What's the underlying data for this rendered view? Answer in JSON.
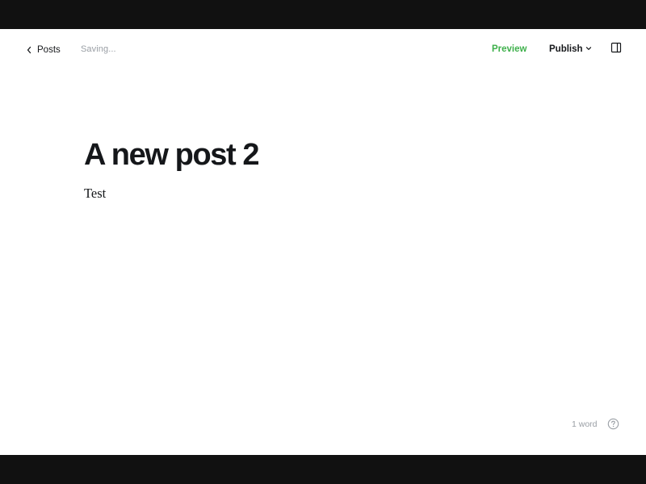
{
  "header": {
    "back_label": "Posts",
    "status": "Saving...",
    "preview_label": "Preview",
    "publish_label": "Publish",
    "settings_icon": "sidebar-toggle-icon",
    "accent_color": "#3eb04b"
  },
  "post": {
    "title": "A new post 2",
    "body": "Test"
  },
  "footer": {
    "word_count": "1 word",
    "help_icon": "question-icon"
  }
}
